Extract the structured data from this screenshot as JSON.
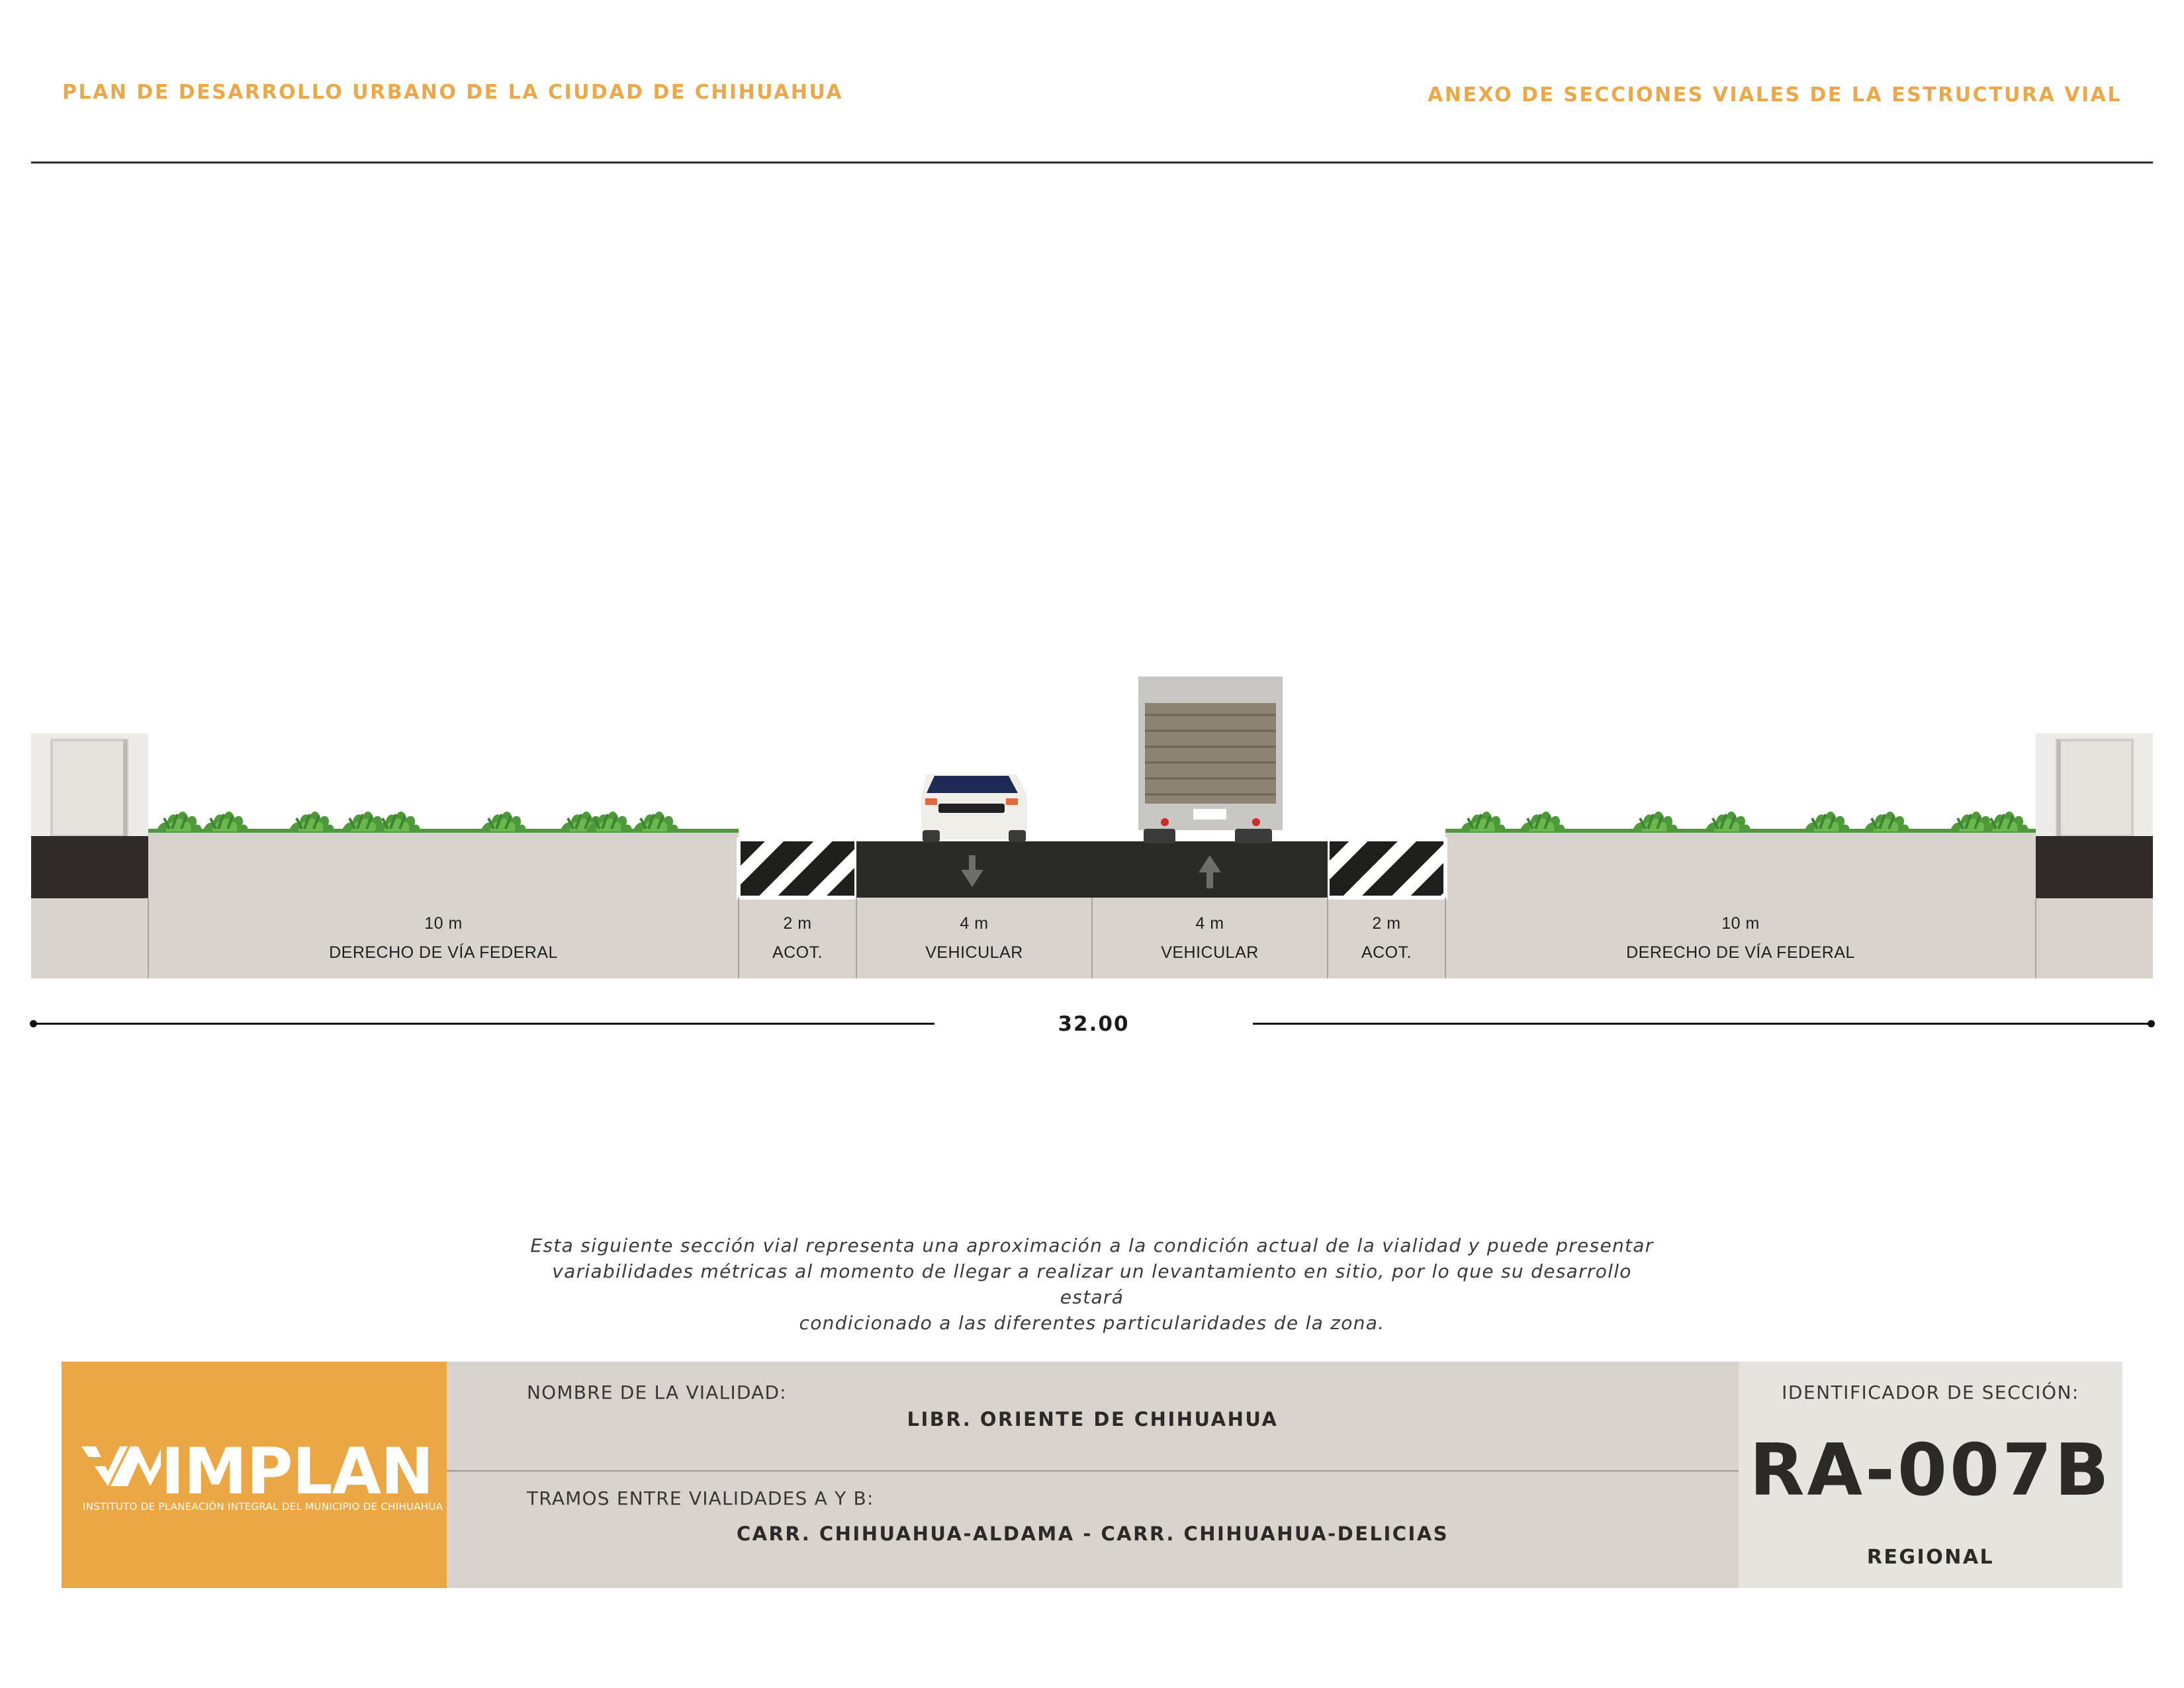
{
  "header": {
    "left_title": "PLAN DE DESARROLLO URBANO DE LA CIUDAD DE CHIHUAHUA",
    "right_title": "ANEXO DE SECCIONES VIALES DE LA ESTRUCTURA VIAL"
  },
  "section": {
    "segments": [
      {
        "width": "10 m",
        "name": "DERECHO DE VÍA FEDERAL",
        "kind": "green"
      },
      {
        "width": "2 m",
        "name": "ACOT.",
        "kind": "shoulder"
      },
      {
        "width": "4 m",
        "name": "VEHICULAR",
        "kind": "lane",
        "direction": "down"
      },
      {
        "width": "4 m",
        "name": "VEHICULAR",
        "kind": "lane",
        "direction": "up"
      },
      {
        "width": "2 m",
        "name": "ACOT.",
        "kind": "shoulder"
      },
      {
        "width": "10 m",
        "name": "DERECHO DE VÍA FEDERAL",
        "kind": "green"
      }
    ],
    "total_width": "32.00",
    "colors": {
      "pavement": "#2a2b29",
      "ground": "#d8d3cc",
      "curb": "#302b28",
      "vegetation": "#4e9a3b",
      "accent": "#eaa744"
    }
  },
  "note": {
    "lines": [
      "Esta siguiente sección vial representa una aproximación a la condición actual de la vialidad y puede presentar",
      "variabilidades métricas al momento de llegar a realizar un levantamiento en sitio, por lo que su desarrollo estará",
      "condicionado a las diferentes particularidades de la zona."
    ]
  },
  "footer": {
    "logo": {
      "name": "IMPLAN",
      "subtitle": "INSTITUTO DE PLANEACIÓN INTEGRAL DEL MUNICIPIO DE CHIHUAHUA"
    },
    "road_name_label": "NOMBRE DE LA VIALIDAD:",
    "road_name": "LIBR. ORIENTE DE CHIHUAHUA",
    "tramos_label": "TRAMOS ENTRE VIALIDADES A Y B:",
    "tramos": "CARR. CHIHUAHUA-ALDAMA - CARR. CHIHUAHUA-DELICIAS",
    "id_label": "IDENTIFICADOR DE SECCIÓN:",
    "id_code": "RA-007B",
    "id_type": "REGIONAL"
  }
}
